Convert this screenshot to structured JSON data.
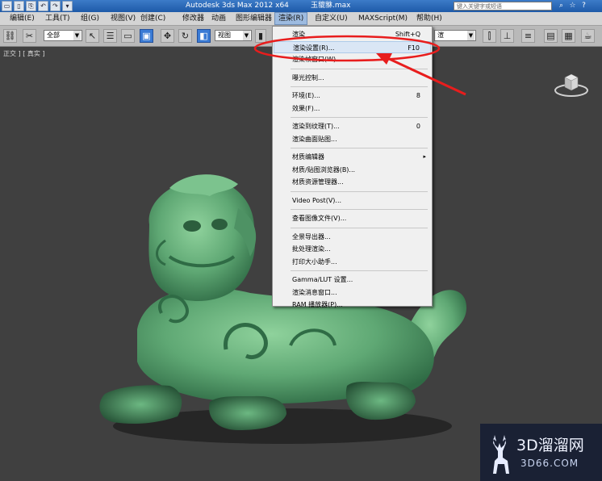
{
  "titlebar": {
    "title": "Autodesk 3ds Max  2012 x64",
    "file": "玉貔貅.max",
    "search_placeholder": "键入关键字或短语",
    "quick_access": [
      "▭",
      "▯",
      "⎘",
      "↶",
      "↷",
      "▾"
    ],
    "icons": [
      "⌕",
      "☆",
      "?"
    ]
  },
  "menubar": {
    "items": [
      "编辑(E)",
      "工具(T)",
      "组(G)",
      "视图(V)",
      "创建(C)",
      "修改器",
      "动画",
      "图形编辑器",
      "渲染(R)",
      "自定义(U)",
      "MAXScript(M)",
      "帮助(H)"
    ],
    "active": "渲染(R)"
  },
  "toolbar": {
    "filter_select": "全部",
    "view_select": "视图",
    "named_select": "渲"
  },
  "viewport": {
    "label": "正交 ] [ 真实 ]"
  },
  "render_menu": {
    "items": [
      {
        "label": "渲染",
        "shortcut": "Shift+Q"
      },
      {
        "label": "渲染设置(R)...",
        "shortcut": "F10",
        "highlighted": true
      },
      {
        "label": "渲染帧窗口(W)...",
        "shortcut": ""
      },
      {
        "sep": true
      },
      {
        "label": "曝光控制...",
        "shortcut": ""
      },
      {
        "sep": true
      },
      {
        "label": "环境(E)...",
        "shortcut": "8"
      },
      {
        "label": "效果(F)...",
        "shortcut": ""
      },
      {
        "sep": true
      },
      {
        "label": "渲染到纹理(T)...",
        "shortcut": "0"
      },
      {
        "label": "渲染曲面贴图...",
        "shortcut": ""
      },
      {
        "sep": true
      },
      {
        "label": "材质编辑器",
        "shortcut": "",
        "submenu": true
      },
      {
        "label": "材质/贴图浏览器(B)...",
        "shortcut": ""
      },
      {
        "label": "材质资源管理器...",
        "shortcut": ""
      },
      {
        "sep": true
      },
      {
        "label": "Video Post(V)...",
        "shortcut": ""
      },
      {
        "sep": true
      },
      {
        "label": "查看图像文件(V)...",
        "shortcut": ""
      },
      {
        "sep": true
      },
      {
        "label": "全景导出器...",
        "shortcut": ""
      },
      {
        "label": "批处理渲染...",
        "shortcut": ""
      },
      {
        "label": "打印大小助手...",
        "shortcut": ""
      },
      {
        "sep": true
      },
      {
        "label": "Gamma/LUT 设置...",
        "shortcut": ""
      },
      {
        "label": "渲染消息窗口...",
        "shortcut": ""
      },
      {
        "label": "RAM 播放器(P)...",
        "shortcut": ""
      }
    ]
  },
  "watermark": {
    "name": "3D溜溜网",
    "domain": "3D66.COM"
  },
  "colors": {
    "viewport_bg": "#404040",
    "statue": "#5fa874",
    "annotation": "#e81d1d",
    "highlight": "#dae6f5"
  }
}
